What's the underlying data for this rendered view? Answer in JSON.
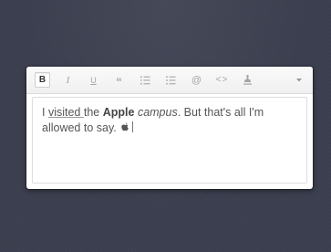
{
  "toolbar": {
    "buttons": [
      {
        "id": "bold",
        "glyph": "B",
        "icon": "bold-icon",
        "active": true
      },
      {
        "id": "italic",
        "glyph": "I",
        "icon": "italic-icon"
      },
      {
        "id": "underline",
        "glyph": "U",
        "icon": "underline-icon"
      },
      {
        "id": "quote",
        "glyph": "“",
        "icon": "quote-icon"
      },
      {
        "id": "ordered-list",
        "icon": "ordered-list-icon"
      },
      {
        "id": "unordered-list",
        "icon": "unordered-list-icon"
      },
      {
        "id": "link",
        "glyph": "@",
        "icon": "at-link-icon"
      },
      {
        "id": "code",
        "glyph": "<>",
        "icon": "code-icon"
      },
      {
        "id": "clear-format",
        "icon": "clear-format-icon"
      },
      {
        "id": "more",
        "icon": "chevron-down-icon"
      }
    ]
  },
  "content": {
    "segments": [
      {
        "text": "I ",
        "style": "normal"
      },
      {
        "text": "visited ",
        "style": "underline"
      },
      {
        "text": "the ",
        "style": "normal"
      },
      {
        "text": "Apple",
        "style": "bold"
      },
      {
        "text": " ",
        "style": "normal"
      },
      {
        "text": "campus",
        "style": "italic"
      },
      {
        "text": ". But that's all I'm allowed to say.",
        "style": "normal"
      }
    ],
    "trailing_icon": "apple-logo-icon"
  },
  "colors": {
    "background": "#3a3e4e",
    "editor_bg": "#ffffff",
    "text": "#555555",
    "toolbar_icon": "#a5a5a5"
  }
}
